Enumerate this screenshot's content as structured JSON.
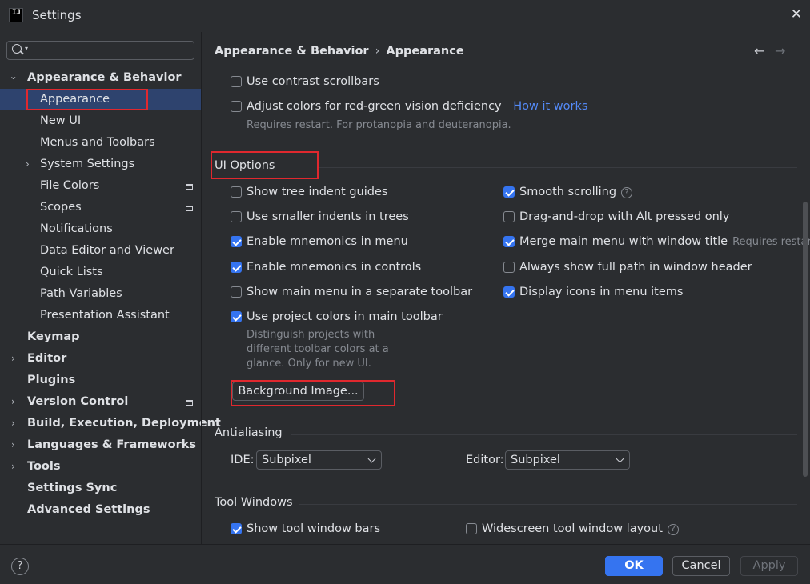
{
  "window": {
    "title": "Settings",
    "logo_text": "IJ",
    "close": "✕"
  },
  "search": {
    "placeholder": ""
  },
  "sidebar": {
    "items": [
      {
        "label": "Appearance & Behavior",
        "bold": true,
        "expanded": true
      },
      {
        "label": "Appearance",
        "selected": true
      },
      {
        "label": "New UI"
      },
      {
        "label": "Menus and Toolbars"
      },
      {
        "label": "System Settings"
      },
      {
        "label": "File Colors"
      },
      {
        "label": "Scopes"
      },
      {
        "label": "Notifications"
      },
      {
        "label": "Data Editor and Viewer"
      },
      {
        "label": "Quick Lists"
      },
      {
        "label": "Path Variables"
      },
      {
        "label": "Presentation Assistant"
      },
      {
        "label": "Keymap"
      },
      {
        "label": "Editor"
      },
      {
        "label": "Plugins"
      },
      {
        "label": "Version Control"
      },
      {
        "label": "Build, Execution, Deployment"
      },
      {
        "label": "Languages & Frameworks"
      },
      {
        "label": "Tools"
      },
      {
        "label": "Settings Sync"
      },
      {
        "label": "Advanced Settings"
      }
    ]
  },
  "breadcrumb": {
    "parent": "Appearance & Behavior",
    "separator": "›",
    "current": "Appearance"
  },
  "nav": {
    "back": "←",
    "forward": "→"
  },
  "top_options": {
    "contrast_scrollbars": {
      "label": "Use contrast scrollbars",
      "checked": false
    },
    "red_green": {
      "label": "Adjust colors for red-green vision deficiency",
      "checked": false,
      "link": "How it works",
      "note": "Requires restart. For protanopia and deuteranopia."
    }
  },
  "ui_options": {
    "title": "UI Options",
    "left": [
      {
        "label": "Show tree indent guides",
        "checked": false
      },
      {
        "label": "Use smaller indents in trees",
        "checked": false
      },
      {
        "label": "Enable mnemonics in menu",
        "checked": true
      },
      {
        "label": "Enable mnemonics in controls",
        "checked": true
      },
      {
        "label": "Show main menu in a separate toolbar",
        "checked": false
      },
      {
        "label": "Use project colors in main toolbar",
        "checked": true
      }
    ],
    "project_colors_note": [
      "Distinguish projects with",
      "different toolbar colors at a",
      "glance. Only for new UI."
    ],
    "right": [
      {
        "label": "Smooth scrolling",
        "checked": true,
        "help": "?"
      },
      {
        "label": "Drag-and-drop with Alt pressed only",
        "checked": false
      },
      {
        "label": "Merge main menu with window title",
        "checked": true,
        "note": "Requires restart"
      },
      {
        "label": "Always show full path in window header",
        "checked": false
      },
      {
        "label": "Display icons in menu items",
        "checked": true
      }
    ],
    "background_button": "Background Image..."
  },
  "antialiasing": {
    "title": "Antialiasing",
    "ide_label": "IDE:",
    "ide_value": "Subpixel",
    "editor_label": "Editor:",
    "editor_value": "Subpixel"
  },
  "tool_windows": {
    "title": "Tool Windows",
    "show_bars": {
      "label": "Show tool window bars",
      "checked": true
    },
    "widescreen": {
      "label": "Widescreen tool window layout",
      "checked": false,
      "help": "?"
    }
  },
  "footer": {
    "help": "?",
    "ok": "OK",
    "cancel": "Cancel",
    "apply": "Apply"
  },
  "colors": {
    "accent": "#3574f0",
    "selection": "#2e436e",
    "highlight_box": "#e0282e",
    "link": "#548af7"
  }
}
